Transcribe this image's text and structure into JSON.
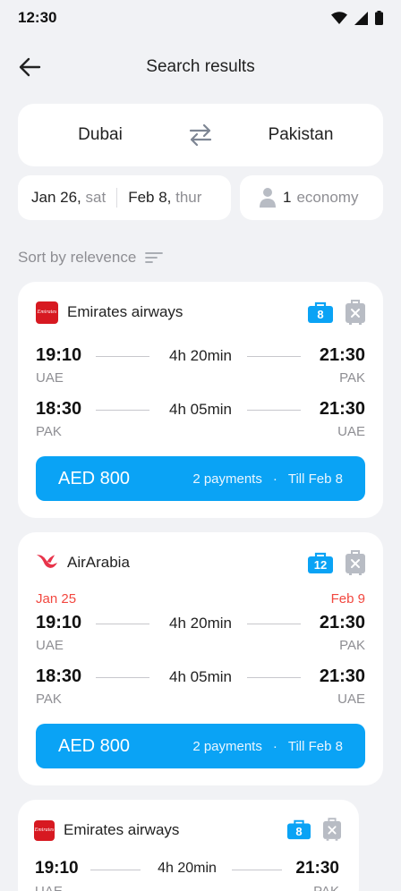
{
  "status": {
    "time": "12:30"
  },
  "header": {
    "title": "Search results"
  },
  "route": {
    "from": "Dubai",
    "to": "Pakistan"
  },
  "dates": {
    "depart_date": "Jan 26,",
    "depart_day": "sat",
    "return_date": "Feb 8,",
    "return_day": "thur"
  },
  "passengers": {
    "count": "1",
    "class": "economy"
  },
  "sort": {
    "label": "Sort by relevence"
  },
  "colors": {
    "accent": "#0aa3f5",
    "alert": "#f2473f",
    "background": "#f1f2f5"
  },
  "flights": [
    {
      "airline": "Emirates airways",
      "logo_icon": "emirates-logo",
      "cabin_bag": "8",
      "outbound": {
        "dep_time": "19:10",
        "duration": "4h 20min",
        "arr_time": "21:30",
        "dep_code": "UAE",
        "arr_code": "PAK"
      },
      "inbound": {
        "dep_time": "18:30",
        "duration": "4h 05min",
        "arr_time": "21:30",
        "dep_code": "PAK",
        "arr_code": "UAE"
      },
      "price": "AED 800",
      "payments": "2 payments",
      "dot": "·",
      "till": "Till Feb 8"
    },
    {
      "airline": "AirArabia",
      "logo_icon": "airarabia-logo",
      "cabin_bag": "12",
      "outbound": {
        "dep_date": "Jan 25",
        "arr_date": "Feb 9",
        "dep_time": "19:10",
        "duration": "4h 20min",
        "arr_time": "21:30",
        "dep_code": "UAE",
        "arr_code": "PAK"
      },
      "inbound": {
        "dep_time": "18:30",
        "duration": "4h 05min",
        "arr_time": "21:30",
        "dep_code": "PAK",
        "arr_code": "UAE"
      },
      "price": "AED 800",
      "payments": "2 payments",
      "dot": "·",
      "till": "Till Feb 8"
    },
    {
      "airline": "Emirates airways",
      "logo_icon": "emirates-logo",
      "cabin_bag": "8",
      "outbound": {
        "dep_time": "19:10",
        "duration": "4h 20min",
        "arr_time": "21:30",
        "dep_code": "UAE",
        "arr_code": "PAK"
      }
    }
  ]
}
